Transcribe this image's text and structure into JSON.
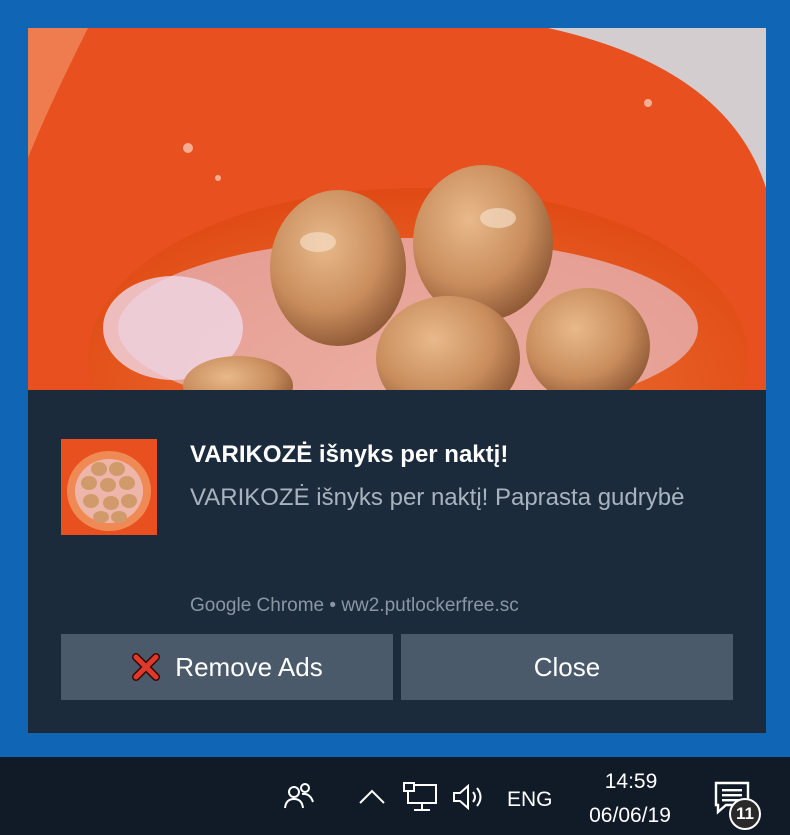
{
  "notification": {
    "title": "VARIKOZĖ išnyks per naktį!",
    "body": "VARIKOZĖ išnyks per naktį! Paprasta gudrybė",
    "attribution": "Google Chrome • ww2.putlockerfree.sc",
    "hero_image": "orange-bowl-with-eggs",
    "thumbnail_image": "orange-bowl-with-eggs",
    "buttons": {
      "remove_ads": "Remove Ads",
      "close": "Close"
    }
  },
  "taskbar": {
    "language": "ENG",
    "time": "14:59",
    "date": "06/06/19",
    "notification_count": "11",
    "icons": [
      "people-icon",
      "chevron-up-icon",
      "network-icon",
      "volume-icon",
      "action-center-icon"
    ]
  },
  "colors": {
    "background": "#1066b5",
    "toast": "#1c2b3b",
    "button": "#4a5a6a",
    "taskbar": "#111b27",
    "bowl_orange": "#e8501f",
    "remove_icon_red": "#e0392b"
  }
}
